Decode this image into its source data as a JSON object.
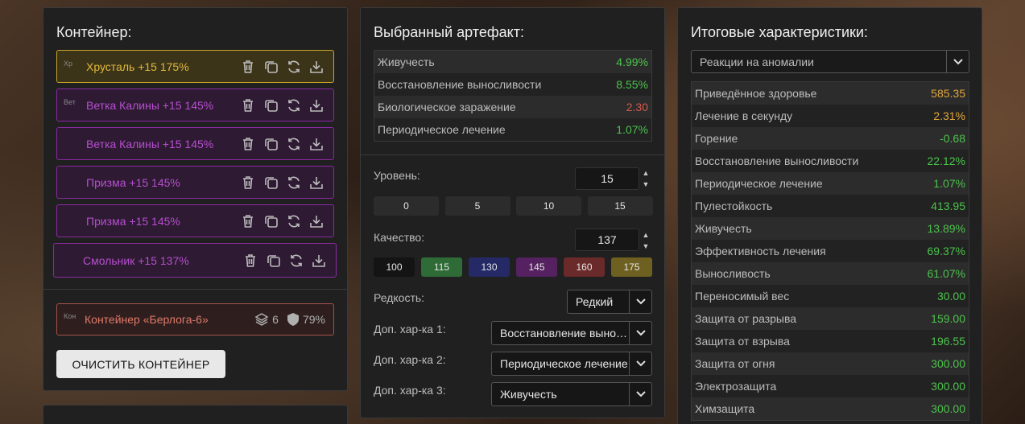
{
  "left": {
    "title": "Контейнер:",
    "artifacts": [
      {
        "name": "Хрусталь +15 175%",
        "img_alt": "Хр",
        "tier": "gold"
      },
      {
        "name": "Ветка Калины +15 145%",
        "img_alt": "Вет",
        "tier": "purple"
      },
      {
        "name": "Ветка Калины +15 145%",
        "img_alt": "",
        "tier": "purple"
      },
      {
        "name": "Призма +15 145%",
        "img_alt": "",
        "tier": "purple"
      },
      {
        "name": "Призма +15 145%",
        "img_alt": "",
        "tier": "purple"
      },
      {
        "name": "Смольник +15 137%",
        "img_alt": "",
        "tier": "purple"
      }
    ],
    "container": {
      "name": "Контейнер «Берлога-6»",
      "img_alt": "Кон",
      "slots": "6",
      "protection": "79%"
    },
    "clear_button": "ОЧИСТИТЬ КОНТЕЙНЕР"
  },
  "middle": {
    "title": "Выбранный артефакт:",
    "stats": [
      {
        "label": "Живучесть",
        "value": "4.99%",
        "color": "green"
      },
      {
        "label": "Восстановление выносливости",
        "value": "8.55%",
        "color": "green"
      },
      {
        "label": "Биологическое заражение",
        "value": "2.30",
        "color": "red"
      },
      {
        "label": "Периодическое лечение",
        "value": "1.07%",
        "color": "green"
      }
    ],
    "level_label": "Уровень:",
    "level_value": "15",
    "level_presets": [
      "0",
      "5",
      "10",
      "15"
    ],
    "quality_label": "Качество:",
    "quality_value": "137",
    "quality_presets": [
      {
        "label": "100",
        "color": "#141414"
      },
      {
        "label": "115",
        "color": "#2f6b36"
      },
      {
        "label": "130",
        "color": "#252a66"
      },
      {
        "label": "145",
        "color": "#552160"
      },
      {
        "label": "160",
        "color": "#6b2a2a"
      },
      {
        "label": "175",
        "color": "#6d6020"
      }
    ],
    "rarity_label": "Редкость:",
    "rarity_value": "Редкий",
    "extra1_label": "Доп. хар-ка 1:",
    "extra1_value": "Восстановление выносливости",
    "extra2_label": "Доп. хар-ка 2:",
    "extra2_value": "Периодическое лечение",
    "extra3_label": "Доп. хар-ка 3:",
    "extra3_value": "Живучесть"
  },
  "right": {
    "title": "Итоговые характеристики:",
    "filter_value": "Реакции на аномалии",
    "stats": [
      {
        "label": "Приведённое здоровье",
        "value": "585.35",
        "color": "yellow"
      },
      {
        "label": "Лечение в секунду",
        "value": "2.31%",
        "color": "yellow"
      },
      {
        "label": "Горение",
        "value": "-0.68",
        "color": "green"
      },
      {
        "label": "Восстановление выносливости",
        "value": "22.12%",
        "color": "green"
      },
      {
        "label": "Периодическое лечение",
        "value": "1.07%",
        "color": "green"
      },
      {
        "label": "Пулестойкость",
        "value": "413.95",
        "color": "green"
      },
      {
        "label": "Живучесть",
        "value": "13.89%",
        "color": "green"
      },
      {
        "label": "Эффективность лечения",
        "value": "69.37%",
        "color": "green"
      },
      {
        "label": "Выносливость",
        "value": "61.07%",
        "color": "green"
      },
      {
        "label": "Переносимый вес",
        "value": "30.00",
        "color": "green"
      },
      {
        "label": "Защита от разрыва",
        "value": "159.00",
        "color": "green"
      },
      {
        "label": "Защита от взрыва",
        "value": "196.55",
        "color": "green"
      },
      {
        "label": "Защита от огня",
        "value": "300.00",
        "color": "green"
      },
      {
        "label": "Электрозащита",
        "value": "300.00",
        "color": "green"
      },
      {
        "label": "Химзащита",
        "value": "300.00",
        "color": "green"
      }
    ]
  }
}
